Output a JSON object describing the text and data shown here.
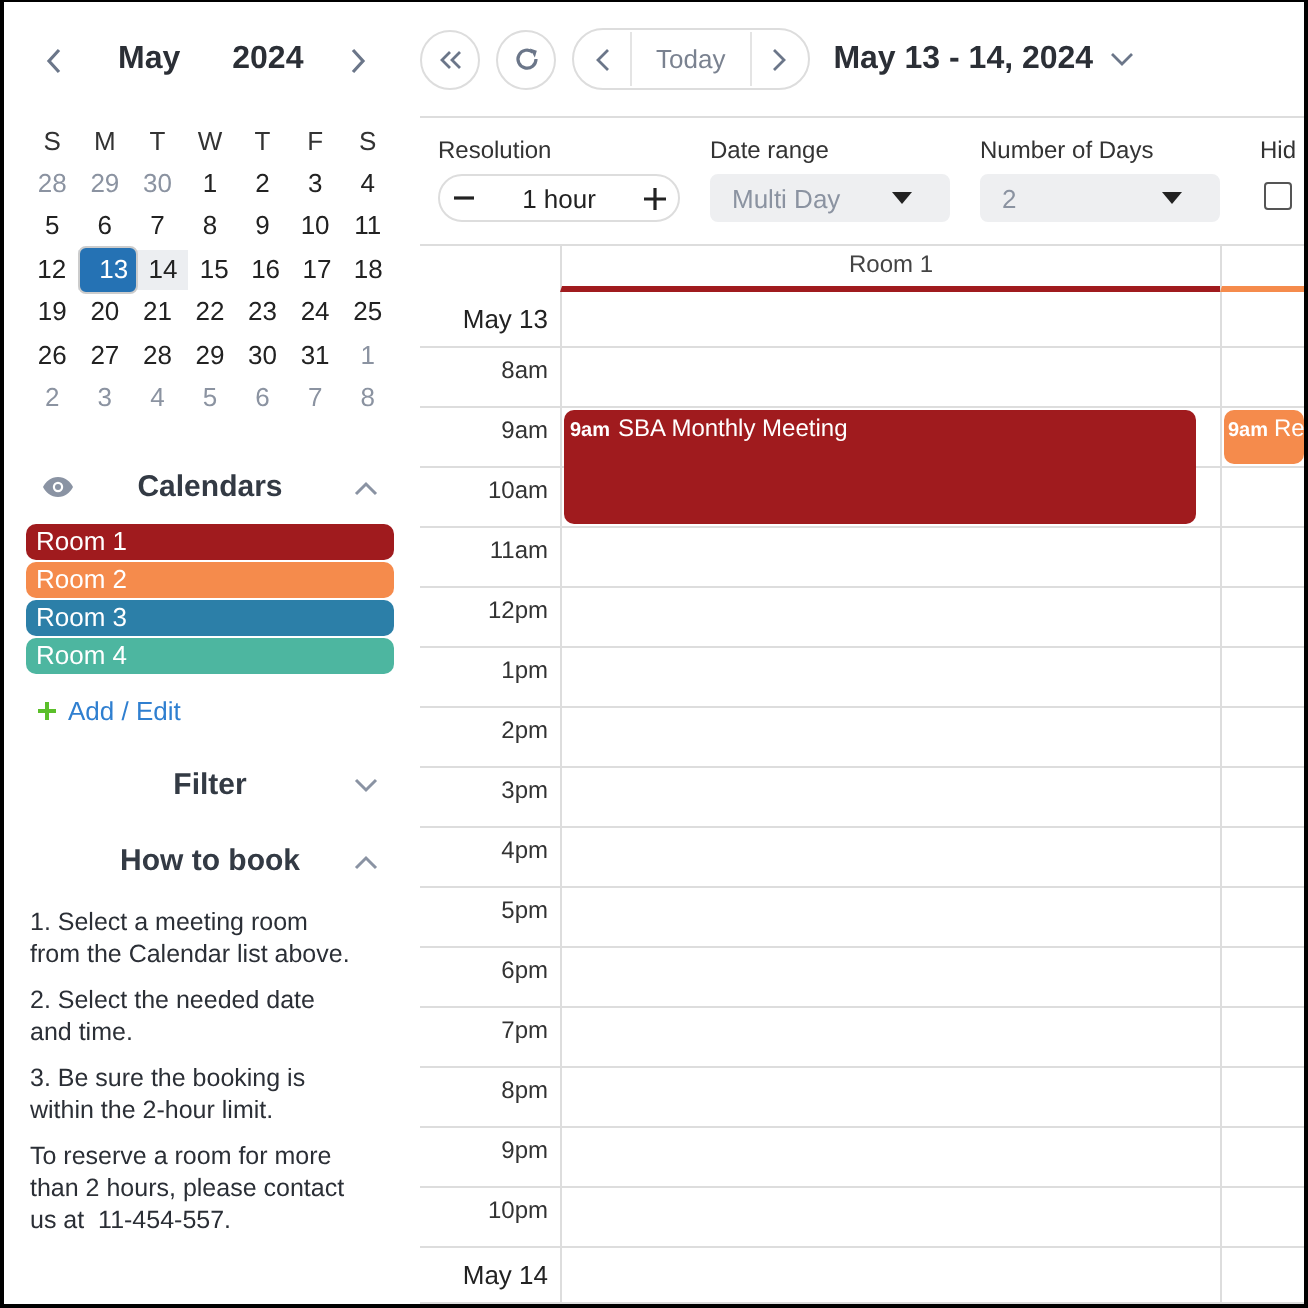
{
  "mini_calendar": {
    "month": "May",
    "year": "2024",
    "weekdays": [
      "S",
      "M",
      "T",
      "W",
      "T",
      "F",
      "S"
    ],
    "weeks": [
      {
        "days": [
          {
            "label": "28",
            "muted": true,
            "selected": false,
            "in_range": false
          },
          {
            "label": "29",
            "muted": true,
            "selected": false,
            "in_range": false
          },
          {
            "label": "30",
            "muted": true,
            "selected": false,
            "in_range": false
          },
          {
            "label": "1",
            "muted": false,
            "selected": false,
            "in_range": false
          },
          {
            "label": "2",
            "muted": false,
            "selected": false,
            "in_range": false
          },
          {
            "label": "3",
            "muted": false,
            "selected": false,
            "in_range": false
          },
          {
            "label": "4",
            "muted": false,
            "selected": false,
            "in_range": false
          }
        ]
      },
      {
        "days": [
          {
            "label": "5",
            "muted": false,
            "selected": false,
            "in_range": false
          },
          {
            "label": "6",
            "muted": false,
            "selected": false,
            "in_range": false
          },
          {
            "label": "7",
            "muted": false,
            "selected": false,
            "in_range": false
          },
          {
            "label": "8",
            "muted": false,
            "selected": false,
            "in_range": false
          },
          {
            "label": "9",
            "muted": false,
            "selected": false,
            "in_range": false
          },
          {
            "label": "10",
            "muted": false,
            "selected": false,
            "in_range": false
          },
          {
            "label": "11",
            "muted": false,
            "selected": false,
            "in_range": false
          }
        ]
      },
      {
        "days": [
          {
            "label": "12",
            "muted": false,
            "selected": false,
            "in_range": false
          },
          {
            "label": "13",
            "muted": false,
            "selected": true,
            "in_range": true
          },
          {
            "label": "14",
            "muted": false,
            "selected": false,
            "in_range": true
          },
          {
            "label": "15",
            "muted": false,
            "selected": false,
            "in_range": false
          },
          {
            "label": "16",
            "muted": false,
            "selected": false,
            "in_range": false
          },
          {
            "label": "17",
            "muted": false,
            "selected": false,
            "in_range": false
          },
          {
            "label": "18",
            "muted": false,
            "selected": false,
            "in_range": false
          }
        ]
      },
      {
        "days": [
          {
            "label": "19",
            "muted": false,
            "selected": false,
            "in_range": false
          },
          {
            "label": "20",
            "muted": false,
            "selected": false,
            "in_range": false
          },
          {
            "label": "21",
            "muted": false,
            "selected": false,
            "in_range": false
          },
          {
            "label": "22",
            "muted": false,
            "selected": false,
            "in_range": false
          },
          {
            "label": "23",
            "muted": false,
            "selected": false,
            "in_range": false
          },
          {
            "label": "24",
            "muted": false,
            "selected": false,
            "in_range": false
          },
          {
            "label": "25",
            "muted": false,
            "selected": false,
            "in_range": false
          }
        ]
      },
      {
        "days": [
          {
            "label": "26",
            "muted": false,
            "selected": false,
            "in_range": false
          },
          {
            "label": "27",
            "muted": false,
            "selected": false,
            "in_range": false
          },
          {
            "label": "28",
            "muted": false,
            "selected": false,
            "in_range": false
          },
          {
            "label": "29",
            "muted": false,
            "selected": false,
            "in_range": false
          },
          {
            "label": "30",
            "muted": false,
            "selected": false,
            "in_range": false
          },
          {
            "label": "31",
            "muted": false,
            "selected": false,
            "in_range": false
          },
          {
            "label": "1",
            "muted": true,
            "selected": false,
            "in_range": false
          }
        ]
      },
      {
        "days": [
          {
            "label": "2",
            "muted": true,
            "selected": false,
            "in_range": false
          },
          {
            "label": "3",
            "muted": true,
            "selected": false,
            "in_range": false
          },
          {
            "label": "4",
            "muted": true,
            "selected": false,
            "in_range": false
          },
          {
            "label": "5",
            "muted": true,
            "selected": false,
            "in_range": false
          },
          {
            "label": "6",
            "muted": true,
            "selected": false,
            "in_range": false
          },
          {
            "label": "7",
            "muted": true,
            "selected": false,
            "in_range": false
          },
          {
            "label": "8",
            "muted": true,
            "selected": false,
            "in_range": false
          }
        ]
      }
    ]
  },
  "calendars": {
    "title": "Calendars",
    "expanded": true,
    "items": [
      {
        "name": "Room 1",
        "color": "#a01b1e"
      },
      {
        "name": "Room 2",
        "color": "#f58b4c"
      },
      {
        "name": "Room 3",
        "color": "#2c7fa8"
      },
      {
        "name": "Room 4",
        "color": "#4db6a0"
      }
    ],
    "add_link": "Add / Edit"
  },
  "filter": {
    "title": "Filter",
    "expanded": false
  },
  "how_to_book": {
    "title": "How to book",
    "expanded": true,
    "paragraphs": [
      "1. Select a meeting room from the Calendar list above.",
      "2. Select the needed date and time.",
      "3. Be sure the booking is within the 2-hour limit.",
      "To reserve a room for more than 2 hours, please contact us at  11-454-557."
    ]
  },
  "toolbar": {
    "today": "Today",
    "range_title": "May 13 - 14, 2024"
  },
  "options": {
    "resolution": {
      "label": "Resolution",
      "value": "1 hour"
    },
    "date_range": {
      "label": "Date range",
      "value": "Multi Day",
      "disabled": true
    },
    "number_of_days": {
      "label": "Number of Days",
      "value": "2",
      "disabled": true
    },
    "hide": {
      "label": "Hid",
      "checked": false
    }
  },
  "schedule": {
    "columns": [
      {
        "name": "Room 1",
        "color": "#a01b1e"
      },
      {
        "color": "#f58b4c"
      }
    ],
    "rows": [
      {
        "label": "May 13",
        "kind": "date"
      },
      {
        "label": "8am",
        "kind": "hour"
      },
      {
        "label": "9am",
        "kind": "hour",
        "cells": [
          {
            "event": {
              "time": "9am",
              "title": "SBA Monthly Meeting",
              "kind": "two-hour"
            }
          },
          {
            "event": {
              "time": "9am",
              "title": "Re",
              "kind": "one-hour"
            }
          }
        ]
      },
      {
        "label": "10am",
        "kind": "hour"
      },
      {
        "label": "11am",
        "kind": "hour"
      },
      {
        "label": "12pm",
        "kind": "hour"
      },
      {
        "label": "1pm",
        "kind": "hour"
      },
      {
        "label": "2pm",
        "kind": "hour"
      },
      {
        "label": "3pm",
        "kind": "hour"
      },
      {
        "label": "4pm",
        "kind": "hour"
      },
      {
        "label": "5pm",
        "kind": "hour"
      },
      {
        "label": "6pm",
        "kind": "hour"
      },
      {
        "label": "7pm",
        "kind": "hour"
      },
      {
        "label": "8pm",
        "kind": "hour"
      },
      {
        "label": "9pm",
        "kind": "hour"
      },
      {
        "label": "10pm",
        "kind": "hour"
      },
      {
        "label": "May 14",
        "kind": "date"
      }
    ]
  }
}
